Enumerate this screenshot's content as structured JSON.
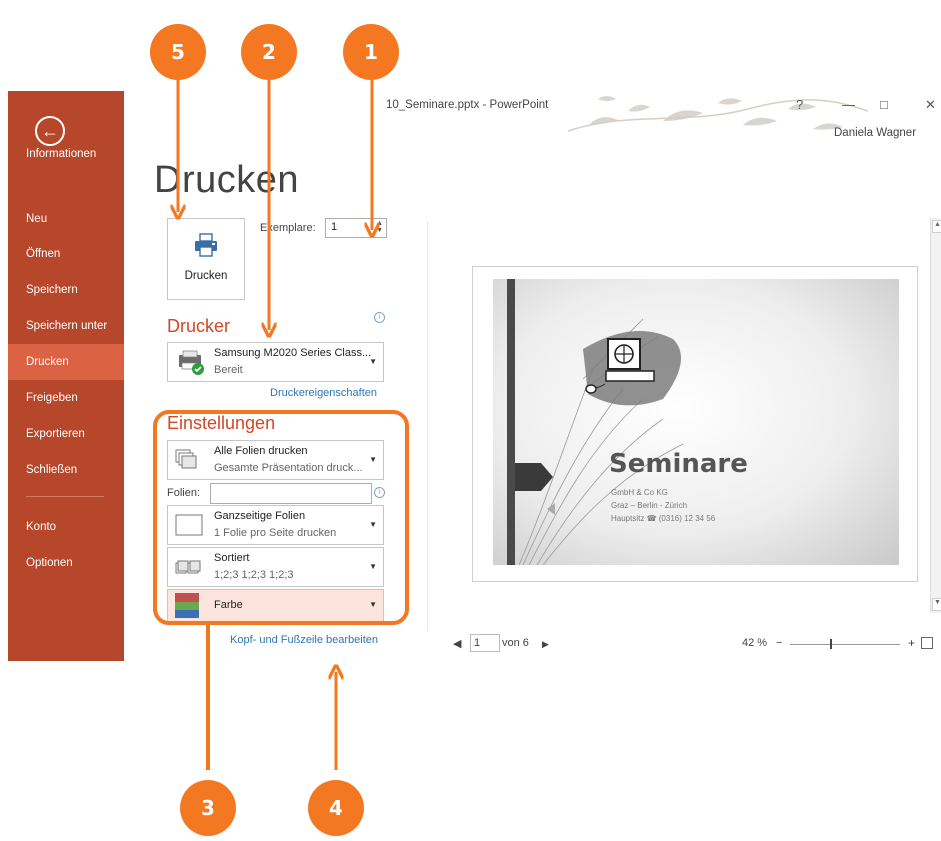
{
  "window": {
    "title": "10_Seminare.pptx - PowerPoint",
    "help_glyph": "?",
    "minimize_glyph": "—",
    "maximize_glyph": "□",
    "close_glyph": "✕",
    "user_name": "Daniela Wagner"
  },
  "sidebar": {
    "back_glyph": "←",
    "items": [
      {
        "label": "Informationen"
      },
      {
        "label": "Neu"
      },
      {
        "label": "Öffnen"
      },
      {
        "label": "Speichern"
      },
      {
        "label": "Speichern unter"
      },
      {
        "label": "Drucken",
        "active": true
      },
      {
        "label": "Freigeben"
      },
      {
        "label": "Exportieren"
      },
      {
        "label": "Schließen"
      },
      {
        "label": "Konto"
      },
      {
        "label": "Optionen"
      }
    ]
  },
  "print": {
    "page_title": "Drucken",
    "print_button_label": "Drucken",
    "copies_label": "Exemplare:",
    "copies_value": "1"
  },
  "printer": {
    "section_title": "Drucker",
    "name": "Samsung M2020 Series Class...",
    "status": "Bereit",
    "properties_link": "Druckereigenschaften"
  },
  "settings": {
    "section_title": "Einstellungen",
    "slides_option": {
      "title": "Alle Folien drucken",
      "subtitle": "Gesamte Präsentation druck..."
    },
    "slides_field_label": "Folien:",
    "slides_field_value": "",
    "layout_option": {
      "title": "Ganzseitige Folien",
      "subtitle": "1 Folie pro Seite drucken"
    },
    "collate_option": {
      "title": "Sortiert",
      "subtitle": "1;2;3   1;2;3   1;2;3"
    },
    "color_option": {
      "title": "Farbe"
    },
    "header_footer_link": "Kopf- und Fußzeile bearbeiten"
  },
  "preview": {
    "slide_title": "Seminare",
    "slide_line1": "GmbH & Co KG",
    "slide_line2": "Graz – Berlin - Zürich",
    "slide_line3": "Hauptsitz ☎ (0316) 12 34 56",
    "page_current": "1",
    "page_of": "von 6",
    "zoom": "42 %"
  },
  "callouts": [
    "5",
    "2",
    "1",
    "3",
    "4"
  ],
  "colors": {
    "accent": "#b7472a",
    "active_nav": "#dc6244",
    "callout": "#f47721",
    "link": "#2e75b6"
  }
}
